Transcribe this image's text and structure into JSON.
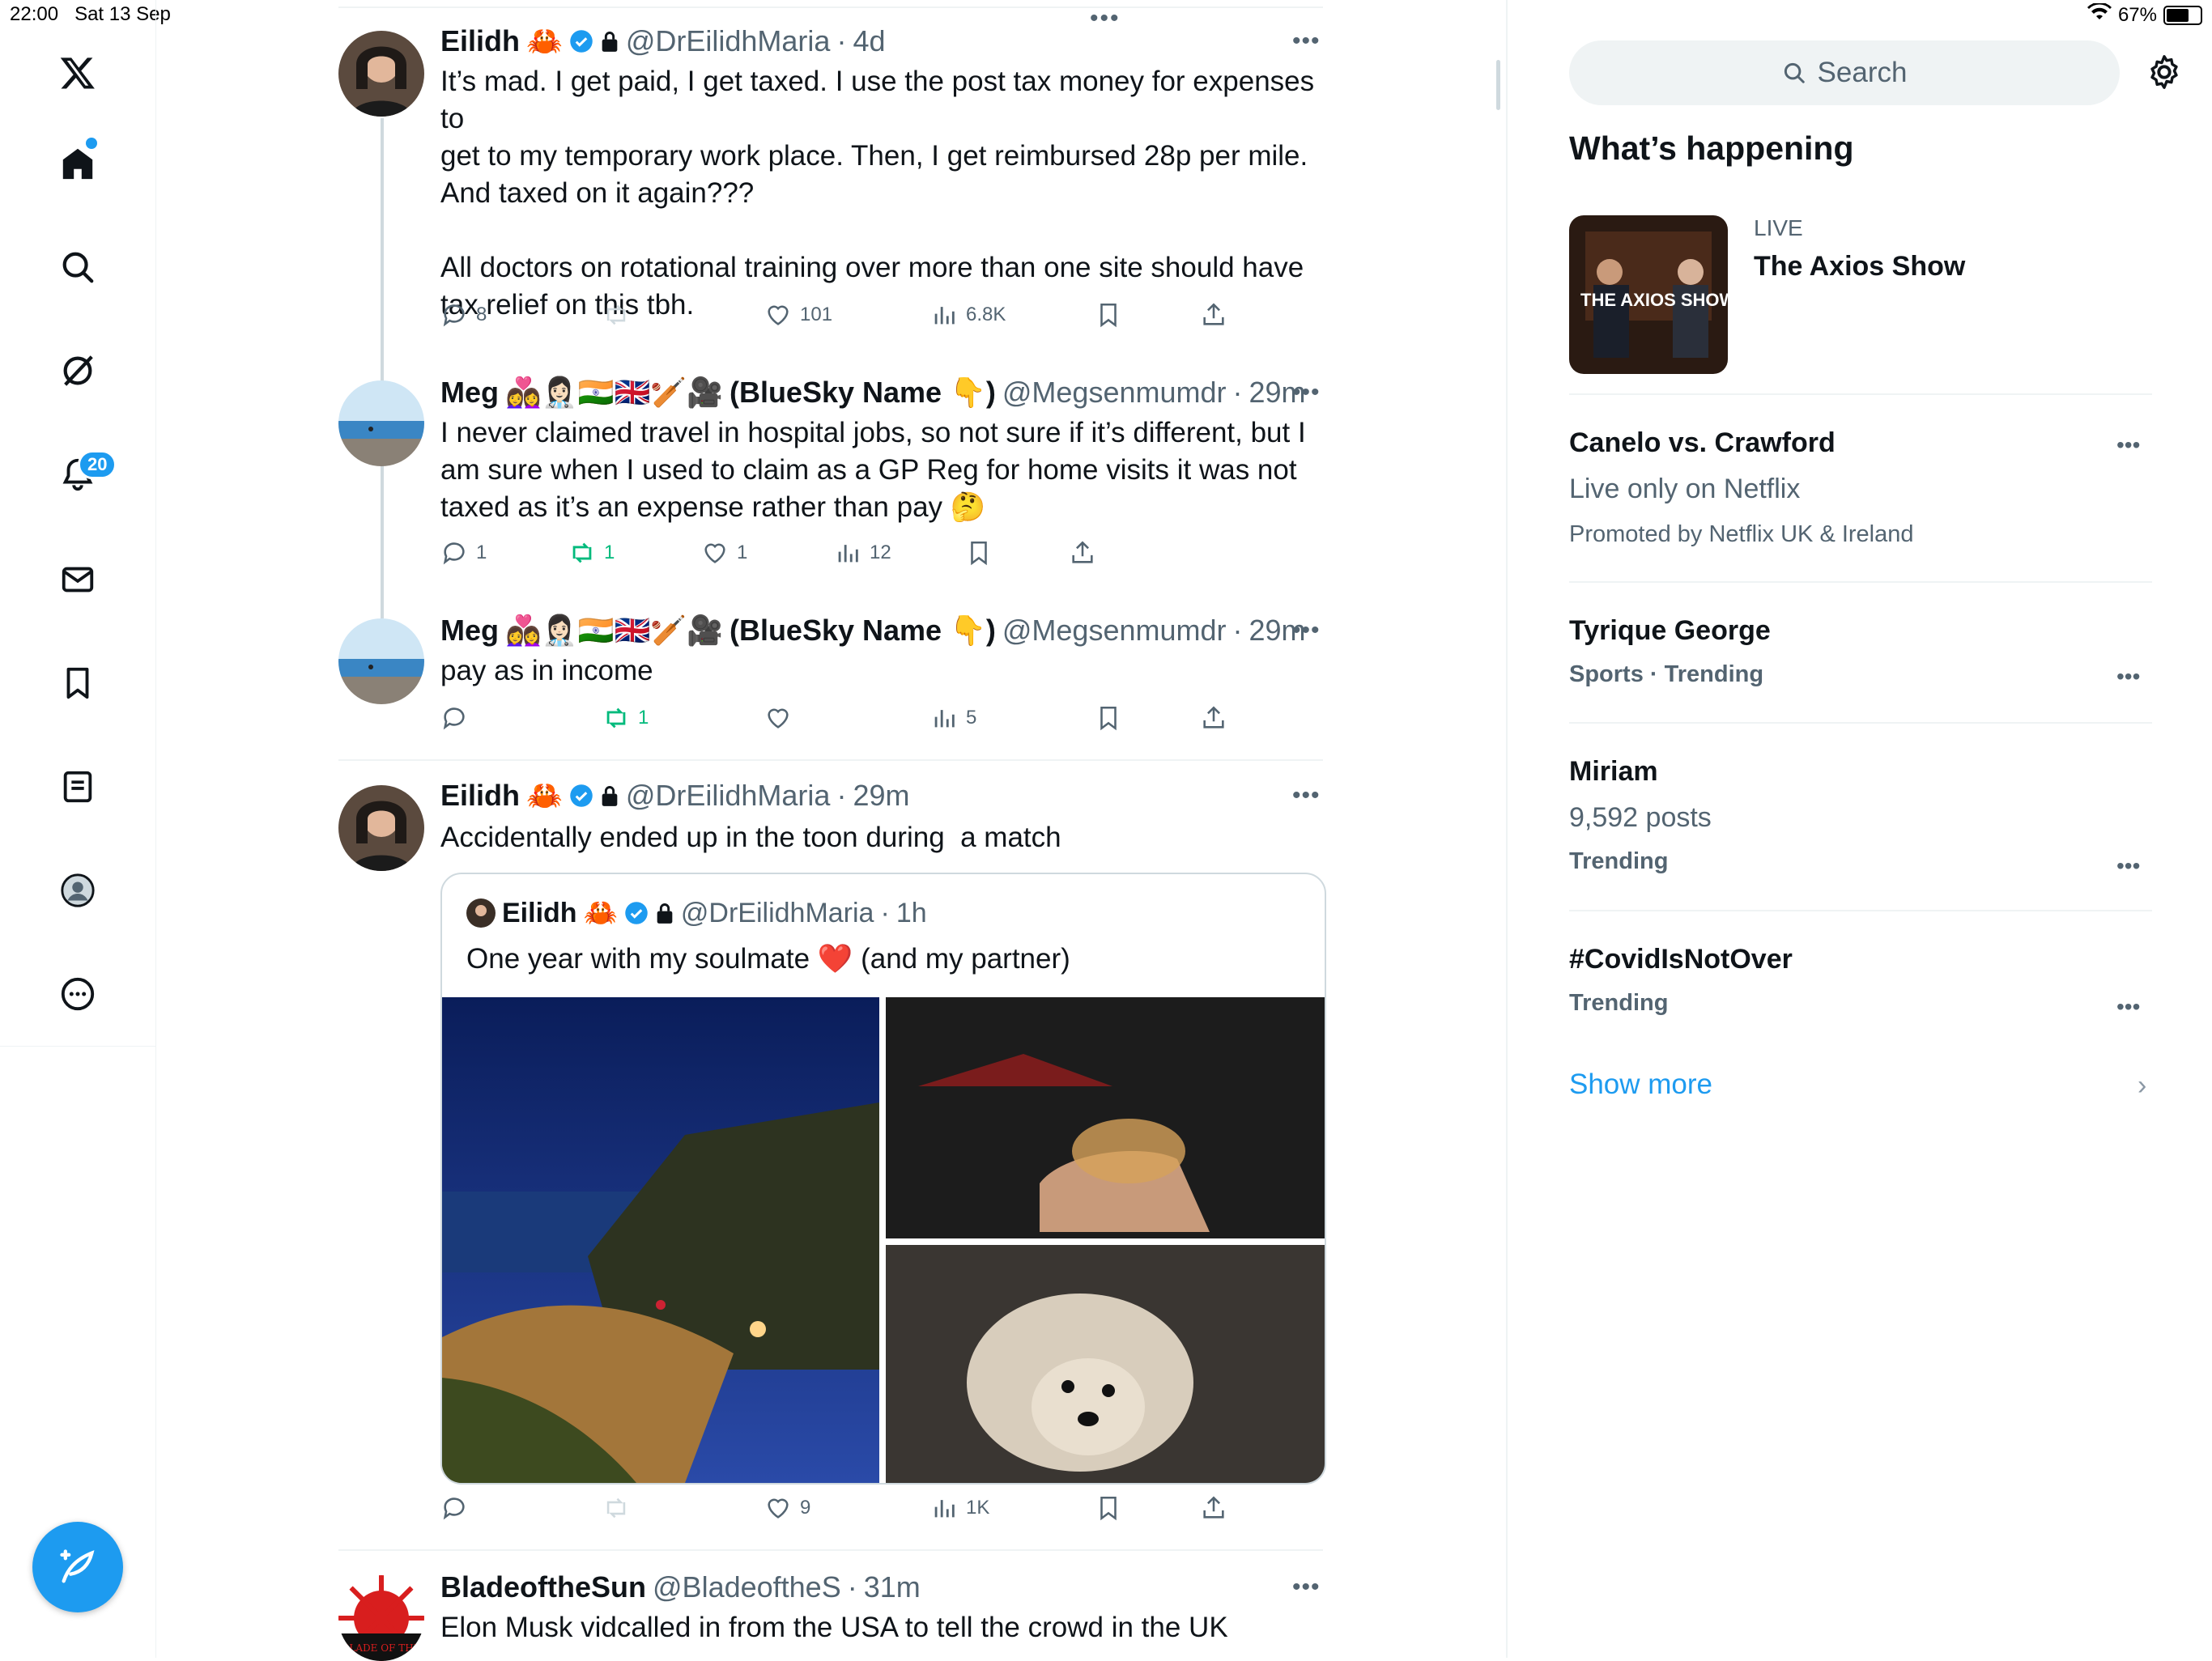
{
  "status": {
    "time": "22:00",
    "date": "Sat 13 Sep",
    "battery": "67%",
    "battery_level": 0.67
  },
  "nav": {
    "items": [
      "x-logo",
      "home",
      "explore",
      "grok",
      "notifications",
      "messages",
      "bookmarks",
      "lists",
      "profile",
      "more"
    ],
    "notifications_badge": "20"
  },
  "tweets": [
    {
      "name": "Eilidh",
      "name_emoji": "🦀",
      "handle": "@DrEilidhMaria",
      "time": "4d",
      "text": "It’s mad. I get paid, I get taxed. I use the post tax money for expenses to\nget to my temporary work place. Then, I get reimbursed 28p per mile.\nAnd taxed on it again???\n\nAll doctors on rotational training over more than one site should have\ntax relief on this tbh.",
      "replies": "8",
      "retweets": "",
      "likes": "101",
      "views": "6.8K"
    },
    {
      "name": "Meg",
      "name_emoji": "👩‍❤️‍👩👩🏻‍⚕️🇮🇳🇬🇧🏏🎥",
      "name_suffix": "(BlueSky Name 👇)",
      "handle": "@Megsenmumdr",
      "time": "29m",
      "text": "I never claimed travel in hospital jobs, so not sure if it’s different, but I\nam sure when I used to claim as a GP Reg for home visits it was not\ntaxed as it’s an expense rather than pay 🤔",
      "replies": "1",
      "retweets": "1",
      "likes": "1",
      "views": "12"
    },
    {
      "name": "Meg",
      "name_emoji": "👩‍❤️‍👩👩🏻‍⚕️🇮🇳🇬🇧🏏🎥",
      "name_suffix": "(BlueSky Name 👇)",
      "handle": "@Megsenmumdr",
      "time": "29m",
      "text": "pay as in income",
      "replies": "",
      "retweets": "1",
      "likes": "",
      "views": "5"
    },
    {
      "name": "Eilidh",
      "name_emoji": "🦀",
      "handle": "@DrEilidhMaria",
      "time": "29m",
      "text": "Accidentally ended up in the toon during  a match",
      "replies": "",
      "retweets": "",
      "likes": "9",
      "views": "1K",
      "quote": {
        "name": "Eilidh",
        "name_emoji": "🦀",
        "handle": "@DrEilidhMaria",
        "time": "1h",
        "text": "One year with my soulmate ❤️ (and my partner)"
      }
    },
    {
      "name": "BladeoftheSun",
      "handle": "@BladeoftheS",
      "time": "31m",
      "text": "Elon Musk vidcalled in from the USA to tell the crowd in the UK",
      "avatar_text": "BLADE OF THE"
    }
  ],
  "sep": "·",
  "right": {
    "search_placeholder": "Search",
    "heading": "What’s happening",
    "live": {
      "label": "LIVE",
      "title": "The Axios Show",
      "thumb_text": "THE AXIOS SHOW"
    },
    "trends": [
      {
        "title": "Canelo vs. Crawford",
        "sub": "Live only on Netflix",
        "meta": "Promoted by Netflix UK & Ireland"
      },
      {
        "title": "Tyrique George",
        "meta": "Sports · Trending"
      },
      {
        "title": "Miriam",
        "sub": "9,592 posts",
        "meta": "Trending"
      },
      {
        "title": "#CovidIsNotOver",
        "meta": "Trending"
      }
    ],
    "show_more": "Show more"
  },
  "colors": {
    "accent": "#1d9bf0",
    "retweet_green": "#00ba7c",
    "text": "#0f1419",
    "secondary": "#536471"
  }
}
